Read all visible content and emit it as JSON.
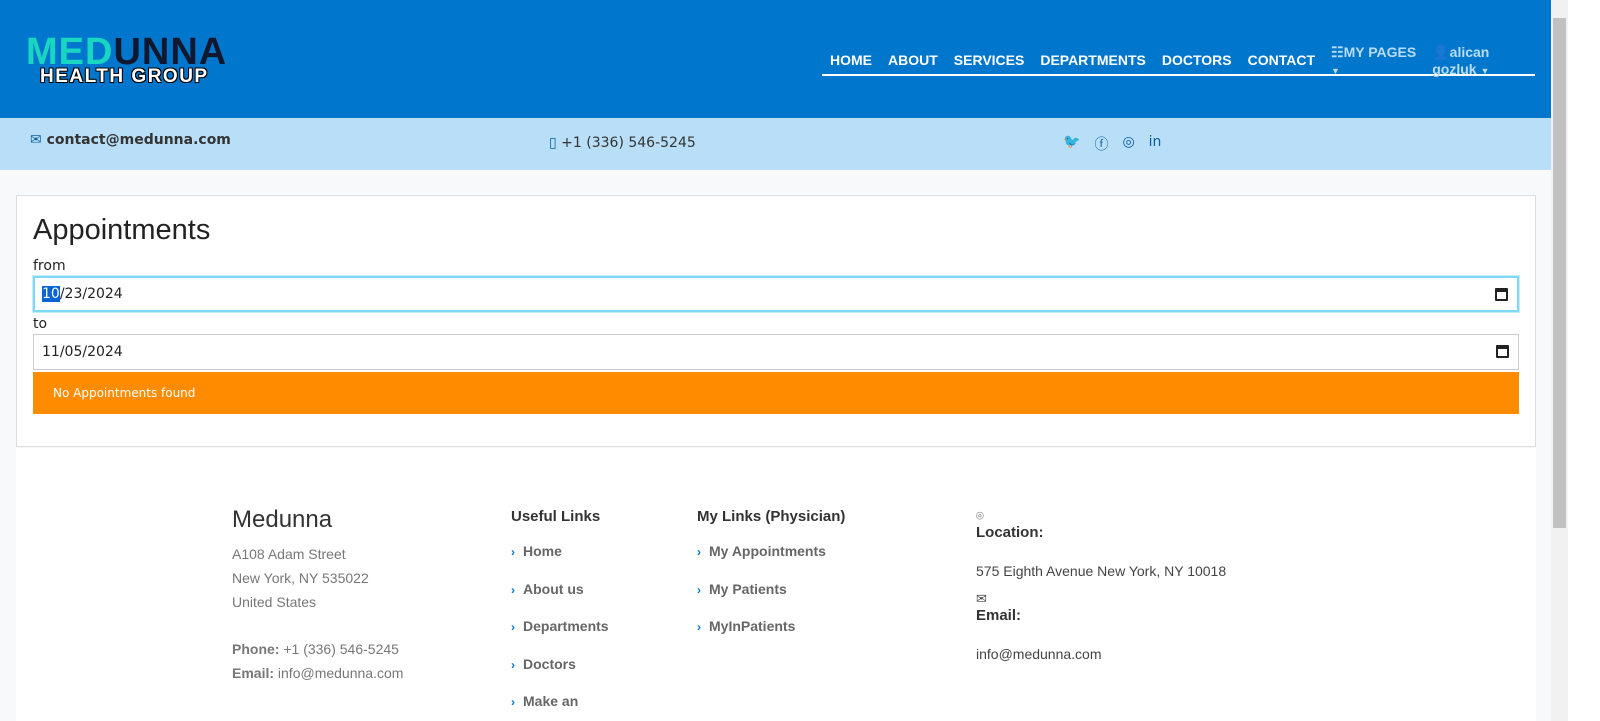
{
  "brand": {
    "line1a": "MED",
    "line1b": "UNNA",
    "line2": "HEALTH GROUP"
  },
  "nav": [
    "HOME",
    "ABOUT",
    "SERVICES",
    "DEPARTMENTS",
    "DOCTORS",
    "CONTACT"
  ],
  "nav_my_pages": "MY PAGES",
  "nav_user": "alican gozluk",
  "topbar": {
    "email": "contact@medunna.com",
    "phone": "+1 (336) 546-5245",
    "social_icons": [
      "twitter-icon",
      "facebook-icon",
      "instagram-icon",
      "linkedin-icon"
    ]
  },
  "appointments": {
    "title": "Appointments",
    "from_label": "from",
    "from_value_sel": "10",
    "from_value_rest": "/23/2024",
    "to_label": "to",
    "to_value": "11/05/2024",
    "alert": "No Appointments found",
    "alert_color": "#ff8c00"
  },
  "footer": {
    "name": "Medunna",
    "address": [
      "A108 Adam Street",
      "New York, NY 535022",
      "United States"
    ],
    "phone_label": "Phone:",
    "phone": "+1 (336) 546-5245",
    "email_label": "Email:",
    "email": "info@medunna.com",
    "useful_title": "Useful Links",
    "useful": [
      "Home",
      "About us",
      "Departments",
      "Doctors",
      "Make an"
    ],
    "my_title": "My Links (Physician)",
    "my": [
      "My Appointments",
      "My Patients",
      "MyInPatients"
    ],
    "location_label": "Location:",
    "location": "575 Eighth Avenue New York, NY 10018",
    "contact_email_label": "Email:",
    "contact_email": "info@medunna.com"
  }
}
